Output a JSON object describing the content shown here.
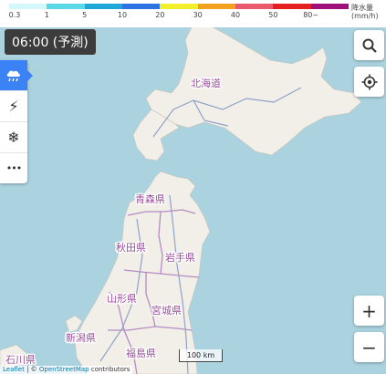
{
  "legend": {
    "ticks": [
      "0.3",
      "1",
      "5",
      "10",
      "20",
      "30",
      "40",
      "50",
      "80~"
    ],
    "colors": [
      "#d4f7f9",
      "#5ad8e7",
      "#1ea8d8",
      "#2d73e3",
      "#f4ef2b",
      "#f2a21e",
      "#ea5a6c",
      "#e62020",
      "#a0107a"
    ],
    "unit_label": "降水量",
    "unit": "(mm/h)"
  },
  "time_badge": "06:00 (予測)",
  "layers": [
    {
      "name": "rain",
      "icon": "rain-cloud-icon",
      "active": true
    },
    {
      "name": "thunder",
      "icon": "lightning-icon",
      "active": false
    },
    {
      "name": "snow",
      "icon": "snowflake-icon",
      "active": false
    },
    {
      "name": "more",
      "icon": "more-dots-icon",
      "active": false
    }
  ],
  "icons": {
    "search": "⌕",
    "locate": "◎",
    "zoom_in": "+",
    "zoom_out": "−",
    "thunder": "⚡",
    "snow": "❄",
    "more": "•••"
  },
  "prefectures": [
    "北海道",
    "青森県",
    "秋田県",
    "岩手県",
    "山形県",
    "宮城県",
    "新潟県",
    "福島県",
    "石川県"
  ],
  "scale": "100 km",
  "attribution": {
    "leaflet": "Leaflet",
    "sep": " | © ",
    "osm": "OpenStreetMap",
    "tail": " contributors"
  },
  "colors": {
    "sea": "#aad3df",
    "land": "#f2efe9",
    "boundary": "#b58bc4",
    "road": "#8fa3c7",
    "active": "#3b82f6"
  }
}
